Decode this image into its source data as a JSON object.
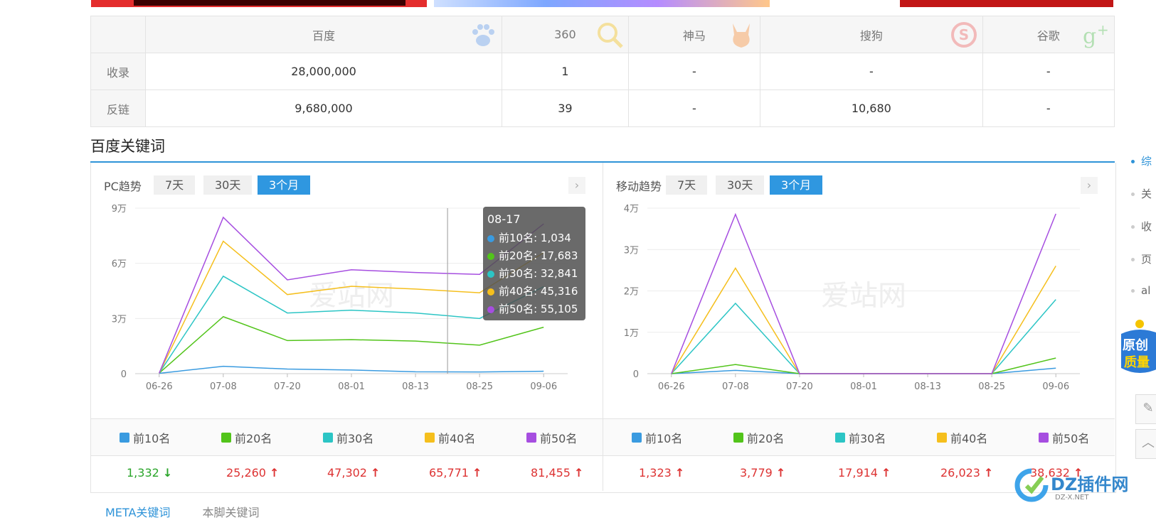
{
  "engines_table": {
    "headers": [
      "百度",
      "360",
      "神马",
      "搜狗",
      "谷歌"
    ],
    "rows": [
      {
        "label": "收录",
        "values": [
          "28,000,000",
          "1",
          "-",
          "-",
          "-"
        ]
      },
      {
        "label": "反链",
        "values": [
          "9,680,000",
          "39",
          "-",
          "10,680",
          "-"
        ]
      }
    ],
    "icons": [
      "baidu-paw-icon",
      "360-search-icon",
      "shenma-icon",
      "sogou-icon",
      "google-plus-icon"
    ]
  },
  "section": {
    "title": "百度关键词"
  },
  "pc": {
    "title": "PC趋势",
    "tabs": [
      "7天",
      "30天",
      "3个月"
    ],
    "active_tab": "3个月",
    "tooltip": {
      "date": "08-17",
      "rows": [
        {
          "label": "前10名: 1,034",
          "color": "#3a9be0"
        },
        {
          "label": "前20名: 17,683",
          "color": "#52c41a"
        },
        {
          "label": "前30名: 32,841",
          "color": "#2cc5c5"
        },
        {
          "label": "前40名: 45,316",
          "color": "#f5bf1d"
        },
        {
          "label": "前50名: 55,105",
          "color": "#a64ee0"
        }
      ]
    },
    "legend": [
      "前10名",
      "前20名",
      "前30名",
      "前40名",
      "前50名"
    ],
    "values": [
      {
        "text": "1,332",
        "trend": "down"
      },
      {
        "text": "25,260",
        "trend": "up"
      },
      {
        "text": "47,302",
        "trend": "up"
      },
      {
        "text": "65,771",
        "trend": "up"
      },
      {
        "text": "81,455",
        "trend": "up"
      }
    ]
  },
  "mobile": {
    "title": "移动趋势",
    "tabs": [
      "7天",
      "30天",
      "3个月"
    ],
    "active_tab": "3个月",
    "legend": [
      "前10名",
      "前20名",
      "前30名",
      "前40名",
      "前50名"
    ],
    "values": [
      {
        "text": "1,323",
        "trend": "up"
      },
      {
        "text": "3,779",
        "trend": "up"
      },
      {
        "text": "17,914",
        "trend": "up"
      },
      {
        "text": "26,023",
        "trend": "up"
      },
      {
        "text": "38,632",
        "trend": "up"
      }
    ]
  },
  "colors": {
    "top10": "#3a9be0",
    "top20": "#52c41a",
    "top30": "#2cc5c5",
    "top40": "#f5bf1d",
    "top50": "#a64ee0",
    "accent": "#2e93d8"
  },
  "chart_data": [
    {
      "type": "line",
      "title": "PC趋势",
      "x": [
        "06-26",
        "07-08",
        "07-20",
        "08-01",
        "08-13",
        "08-25",
        "09-06"
      ],
      "ylim": [
        0,
        90000
      ],
      "yticks": [
        "0",
        "3万",
        "6万",
        "9万"
      ],
      "series": [
        {
          "name": "前10名",
          "values": [
            200,
            4000,
            2500,
            2000,
            1000,
            900,
            1332
          ]
        },
        {
          "name": "前20名",
          "values": [
            300,
            31000,
            18000,
            18500,
            17700,
            15500,
            25260
          ]
        },
        {
          "name": "前30名",
          "values": [
            300,
            53000,
            33000,
            34500,
            33000,
            30000,
            47302
          ]
        },
        {
          "name": "前40名",
          "values": [
            300,
            72000,
            43000,
            47500,
            46000,
            44000,
            65771
          ]
        },
        {
          "name": "前50名",
          "values": [
            300,
            85000,
            51000,
            56500,
            55000,
            54000,
            81455
          ]
        }
      ]
    },
    {
      "type": "line",
      "title": "移动趋势",
      "x": [
        "06-26",
        "07-08",
        "07-20",
        "08-01",
        "08-13",
        "08-25",
        "09-06"
      ],
      "ylim": [
        0,
        40000
      ],
      "yticks": [
        "0",
        "1万",
        "2万",
        "3万",
        "4万"
      ],
      "series": [
        {
          "name": "前10名",
          "values": [
            0,
            800,
            0,
            0,
            0,
            0,
            1323
          ]
        },
        {
          "name": "前20名",
          "values": [
            0,
            2200,
            0,
            0,
            0,
            0,
            3779
          ]
        },
        {
          "name": "前30名",
          "values": [
            0,
            17000,
            0,
            0,
            0,
            0,
            17914
          ]
        },
        {
          "name": "前40名",
          "values": [
            0,
            25500,
            0,
            0,
            0,
            0,
            26023
          ]
        },
        {
          "name": "前50名",
          "values": [
            0,
            38500,
            0,
            0,
            0,
            0,
            38632
          ]
        }
      ]
    }
  ],
  "watermark_chart": "爱站网",
  "bottom_tabs": [
    "META关键词",
    "本脚关键词"
  ],
  "right_rail": [
    "综",
    "关",
    "收",
    "页",
    "al"
  ],
  "side_badge": [
    "原创",
    "质量"
  ],
  "site_watermark": {
    "title": "DZ插件网",
    "sub": "DZ-X.NET"
  }
}
